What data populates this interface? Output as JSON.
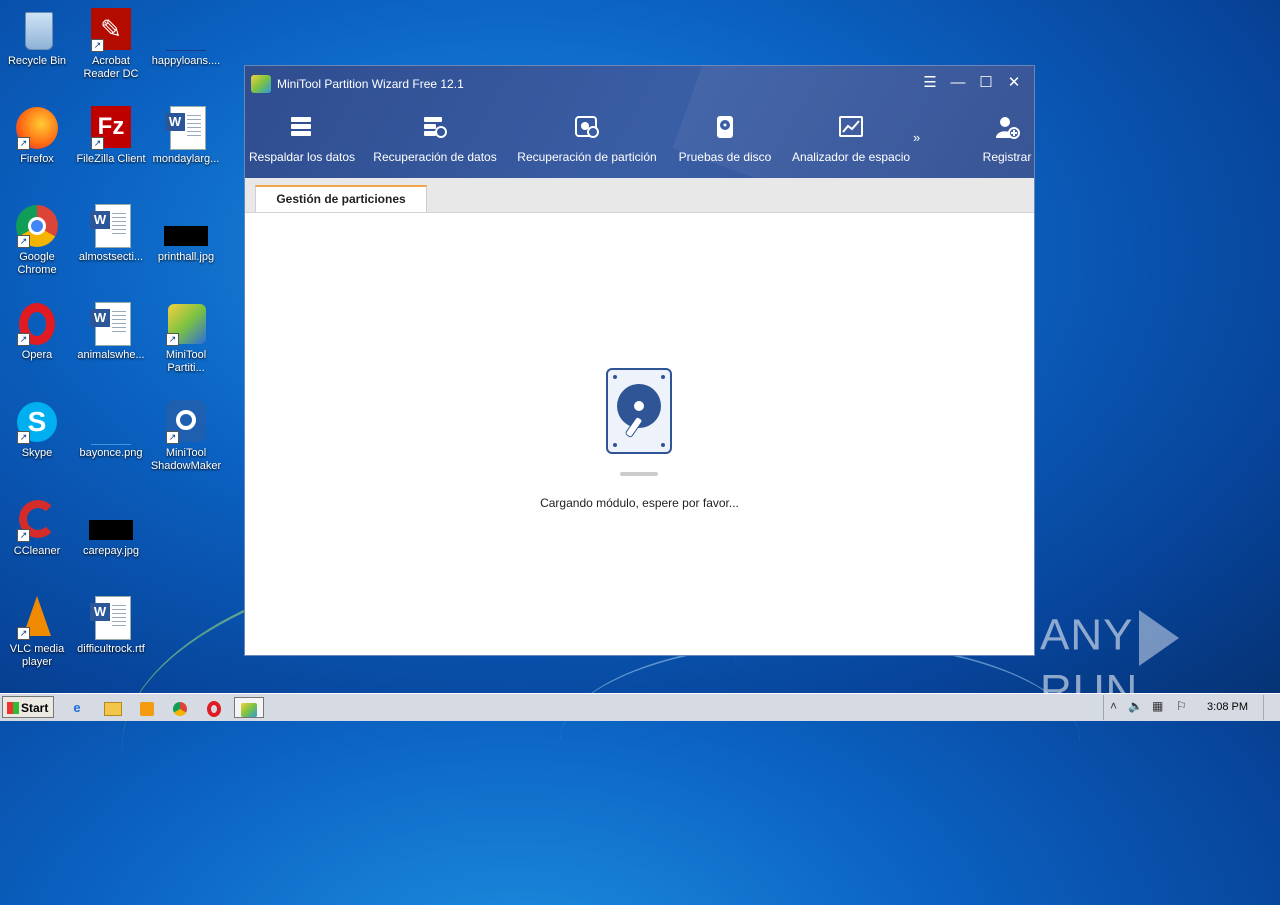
{
  "desktop": {
    "icons": [
      {
        "label": "Recycle Bin"
      },
      {
        "label": "Acrobat Reader DC"
      },
      {
        "label": "happyloans...."
      },
      {
        "label": "Firefox"
      },
      {
        "label": "FileZilla Client"
      },
      {
        "label": "mondaylarg..."
      },
      {
        "label": "Google Chrome"
      },
      {
        "label": "almostsecti..."
      },
      {
        "label": "printhall.jpg"
      },
      {
        "label": "Opera"
      },
      {
        "label": "animalswhe..."
      },
      {
        "label": "MiniTool Partiti..."
      },
      {
        "label": "Skype"
      },
      {
        "label": "bayonce.png"
      },
      {
        "label": "MiniTool ShadowMaker"
      },
      {
        "label": "CCleaner"
      },
      {
        "label": "carepay.jpg"
      },
      {
        "label": "VLC media player"
      },
      {
        "label": "difficultrock.rtf"
      }
    ]
  },
  "window": {
    "title": "MiniTool Partition Wizard Free 12.1",
    "controls": {
      "menu": "☰",
      "minimize": "—",
      "maximize": "☐",
      "close": "✕"
    },
    "toolbar": [
      {
        "label": "Respaldar los datos",
        "icon": "backup-icon"
      },
      {
        "label": "Recuperación de datos",
        "icon": "data-recovery-icon"
      },
      {
        "label": "Recuperación de partición",
        "icon": "partition-recovery-icon"
      },
      {
        "label": "Pruebas de disco",
        "icon": "disk-benchmark-icon"
      },
      {
        "label": "Analizador de espacio",
        "icon": "space-analyzer-icon"
      },
      {
        "label": "Registrar",
        "icon": "register-user-icon"
      }
    ],
    "more": "»",
    "tab": "Gestión de particiones",
    "loading_text": "Cargando módulo, espere por favor..."
  },
  "taskbar": {
    "start": "Start",
    "clock": "3:08 PM"
  },
  "watermark": {
    "left": "ANY",
    "right": "RUN"
  }
}
